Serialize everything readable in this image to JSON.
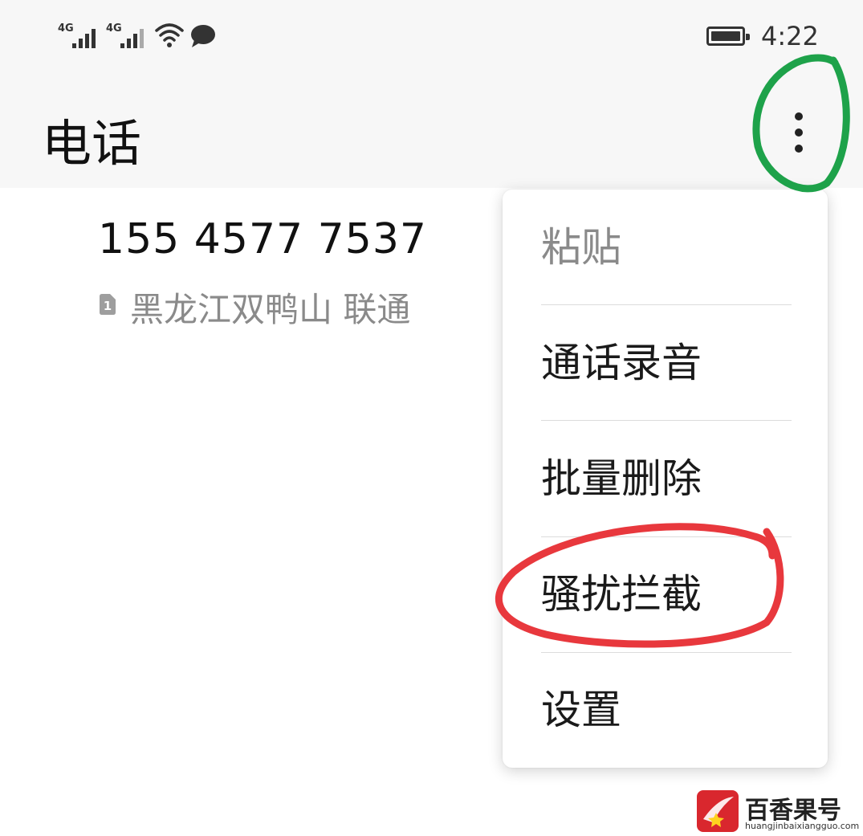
{
  "status_bar": {
    "sim1_network": "4G",
    "sim2_network": "4G",
    "time": "4:22"
  },
  "app_bar": {
    "title": "电话"
  },
  "contact": {
    "number": "155 4577 7537",
    "sim_slot": "1",
    "location": "黑龙江双鸭山 联通"
  },
  "menu": {
    "items": [
      {
        "label": "粘贴",
        "enabled": false
      },
      {
        "label": "通话录音",
        "enabled": true
      },
      {
        "label": "批量删除",
        "enabled": true
      },
      {
        "label": "骚扰拦截",
        "enabled": true
      },
      {
        "label": "设置",
        "enabled": true
      }
    ]
  },
  "annotations": {
    "green_circle_color": "#1ea24a",
    "red_circle_color": "#e8383d"
  },
  "watermark": {
    "name": "百香果号",
    "url": "huangjinbaixiangguo.com"
  }
}
